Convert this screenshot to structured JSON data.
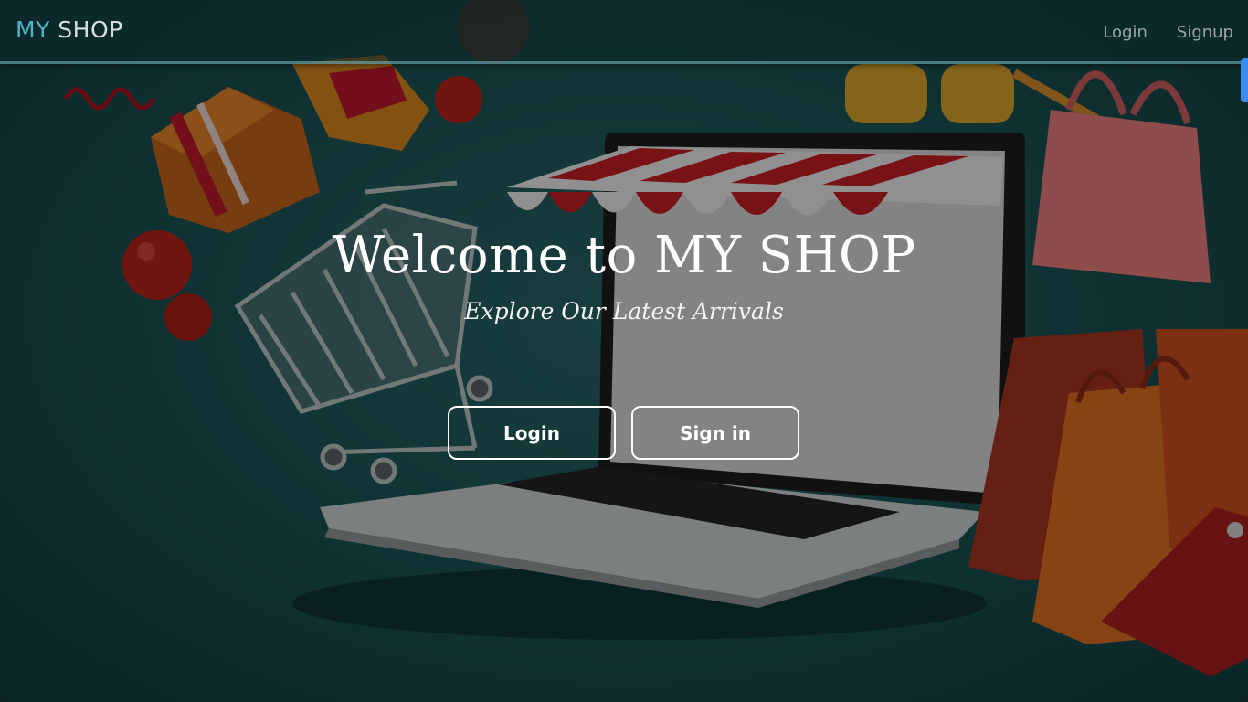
{
  "navbar": {
    "brand_part1": "MY",
    "brand_part2": "SHOP",
    "links": [
      {
        "label": "Login"
      },
      {
        "label": "Signup"
      }
    ]
  },
  "hero": {
    "title": "Welcome to MY SHOP",
    "subtitle": "Explore Our Latest Arrivals",
    "buttons": [
      {
        "label": "Login"
      },
      {
        "label": "Sign in"
      }
    ]
  },
  "colors": {
    "brand_accent": "#4fb3c9",
    "background": "#1c5456",
    "scrollbar_accent": "#3b8cf0"
  }
}
